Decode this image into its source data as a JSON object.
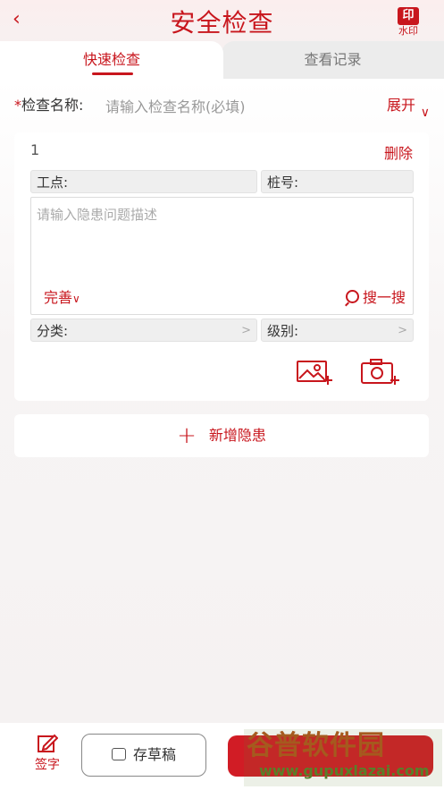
{
  "header": {
    "back_icon": "chevron-left-icon",
    "title": "安全检查",
    "watermark_badge": "印",
    "watermark_label": "水印"
  },
  "tabs": [
    {
      "label": "快速检查",
      "active": true
    },
    {
      "label": "查看记录",
      "active": false
    }
  ],
  "form": {
    "name_required_mark": "*",
    "name_label": "检查名称:",
    "name_placeholder": "请输入检查名称(必填)",
    "expand_label": "展开",
    "expand_icon": "chevron-down-icon"
  },
  "hazard_card": {
    "index": "1",
    "delete_label": "删除",
    "work_point_label": "工点:",
    "pile_number_label": "桩号:",
    "description_placeholder": "请输入隐患问题描述",
    "perfect_label": "完善",
    "search_label": "搜一搜",
    "category_label": "分类:",
    "level_label": "级别:"
  },
  "add_hazard_label": "新增隐患",
  "bottom": {
    "sign_label": "签字",
    "draft_label": "存草稿"
  },
  "overlay": {
    "brand_text": "谷普软件园",
    "brand_url": "www.gupuxlazai.com"
  },
  "colors": {
    "accent": "#c8161d"
  }
}
